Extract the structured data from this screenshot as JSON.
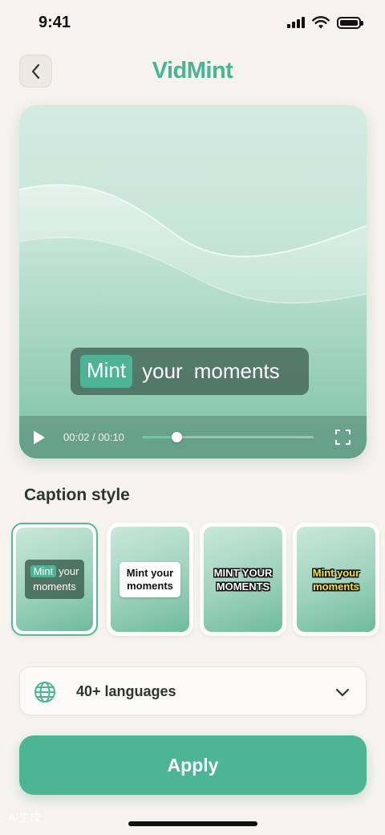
{
  "status_bar": {
    "time": "9:41"
  },
  "header": {
    "title": "VidMint"
  },
  "video": {
    "caption_words": [
      "Mint",
      "your",
      "moments"
    ],
    "time_current": "00:02",
    "time_total": "00:10",
    "time_display": "00:02 / 00:10",
    "progress": 0.2
  },
  "caption_style": {
    "title": "Caption style",
    "styles": [
      {
        "line1_highlight": "Mint",
        "line1_rest": "your",
        "line2": "moments",
        "selected": true
      },
      {
        "line1": "Mint your",
        "line2": "moments",
        "selected": false
      },
      {
        "line1": "MINT YOUR",
        "line2": "MOMENTS",
        "selected": false
      },
      {
        "line1": "Mint your",
        "line2": "moments",
        "selected": false
      }
    ]
  },
  "language": {
    "label": "40+ languages"
  },
  "apply_label": "Apply",
  "watermark": "AI生成",
  "colors": {
    "accent": "#4db594",
    "title": "#48b395",
    "background": "#f6f3ee"
  }
}
